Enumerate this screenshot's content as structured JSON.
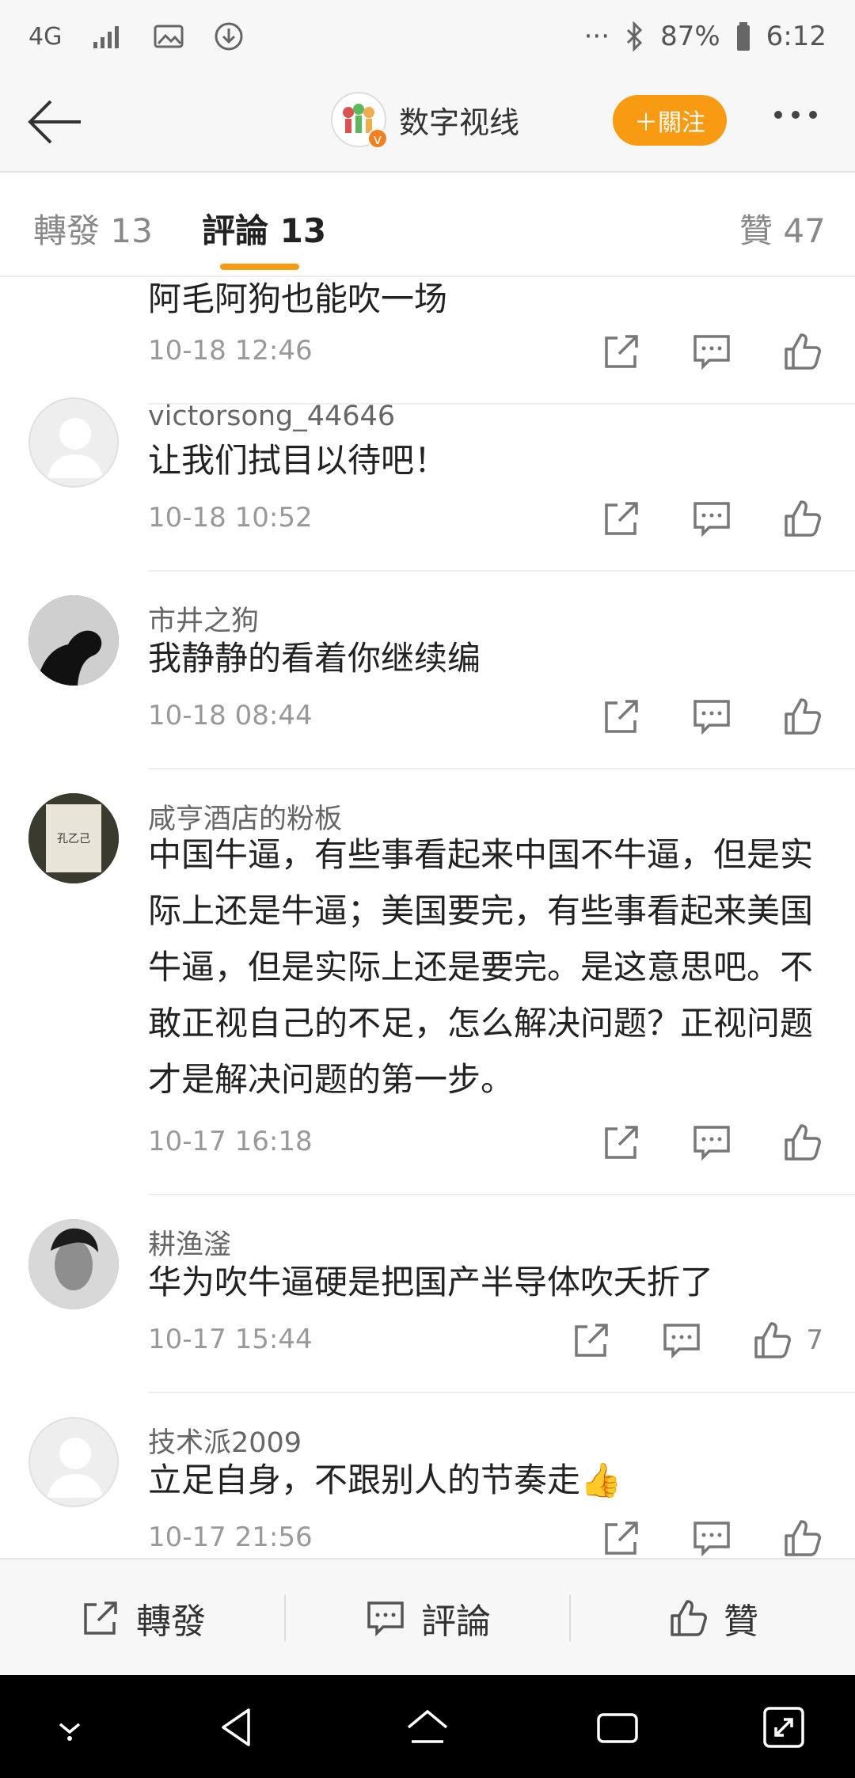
{
  "statusbar": {
    "network": "4G",
    "dots": "···",
    "battery": "87%",
    "time": "6:12"
  },
  "header": {
    "title": "数字视线",
    "follow_label": "＋關注",
    "badge": "v",
    "accent": "#f89a12"
  },
  "tabs": {
    "repost": "轉發 13",
    "comments": "評論 13",
    "likes": "贊 47"
  },
  "comments": [
    {
      "name": "",
      "text": "阿毛阿狗也能吹一场",
      "time": "10-18 12:46",
      "likes": ""
    },
    {
      "name": "victorsong_44646",
      "text": "让我们拭目以待吧！",
      "time": "10-18 10:52",
      "likes": ""
    },
    {
      "name": "市井之狗",
      "text": "我静静的看着你继续编",
      "time": "10-18 08:44",
      "likes": ""
    },
    {
      "name": "咸亨酒店的粉板",
      "text": "中国牛逼，有些事看起来中国不牛逼，但是实际上还是牛逼；美国要完，有些事看起来美国牛逼，但是实际上还是要完。是这意思吧。不敢正视自己的不足，怎么解决问题？正视问题才是解决问题的第一步。",
      "time": "10-17 16:18",
      "likes": ""
    },
    {
      "name": "耕渔滏",
      "text": "华为吹牛逼硬是把国产半导体吹夭折了",
      "time": "10-17 15:44",
      "likes": "7"
    },
    {
      "name": "技术派2009",
      "text": "立足自身，不跟别人的节奏走👍",
      "time": "10-17 21:56",
      "likes": ""
    }
  ],
  "avatar_text": {
    "kongyiji": "孔乙己"
  },
  "bottombar": {
    "repost": "轉發",
    "comment": "評論",
    "like": "贊"
  }
}
